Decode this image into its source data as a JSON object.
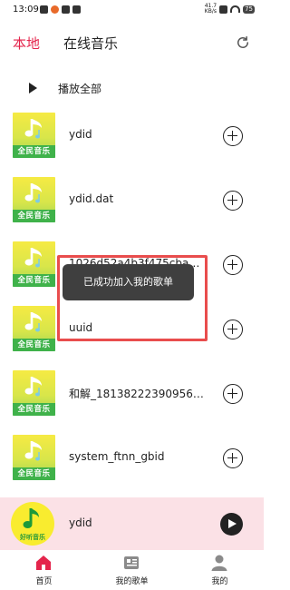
{
  "status_bar": {
    "time": "13:09",
    "speed_top": "41.7",
    "speed_unit": "KB/s",
    "battery": "75"
  },
  "header": {
    "tab_local": "本地",
    "tab_online": "在线音乐",
    "refresh_icon": "refresh-icon"
  },
  "play_all": {
    "label": "播放全部"
  },
  "cover_brand": "全民音乐",
  "songs": [
    {
      "title": "ydid"
    },
    {
      "title": "ydid.dat"
    },
    {
      "title": "1026d52a4b3f475cba3…"
    },
    {
      "title": "uuid"
    },
    {
      "title": "和解_181382223909565…"
    },
    {
      "title": "system_ftnn_gbid"
    }
  ],
  "toast": {
    "message": "已成功加入我的歌单"
  },
  "player": {
    "title": "ydid",
    "brand": "好听音乐"
  },
  "nav": [
    {
      "label": "首页",
      "icon": "home-icon"
    },
    {
      "label": "我的歌单",
      "icon": "playlist-icon"
    },
    {
      "label": "我的",
      "icon": "profile-icon"
    }
  ],
  "colors": {
    "accent": "#e4254c",
    "player_bg": "#fbe1e6",
    "toast_bg": "#3f3f3f",
    "highlight_border": "#e94d4d"
  }
}
